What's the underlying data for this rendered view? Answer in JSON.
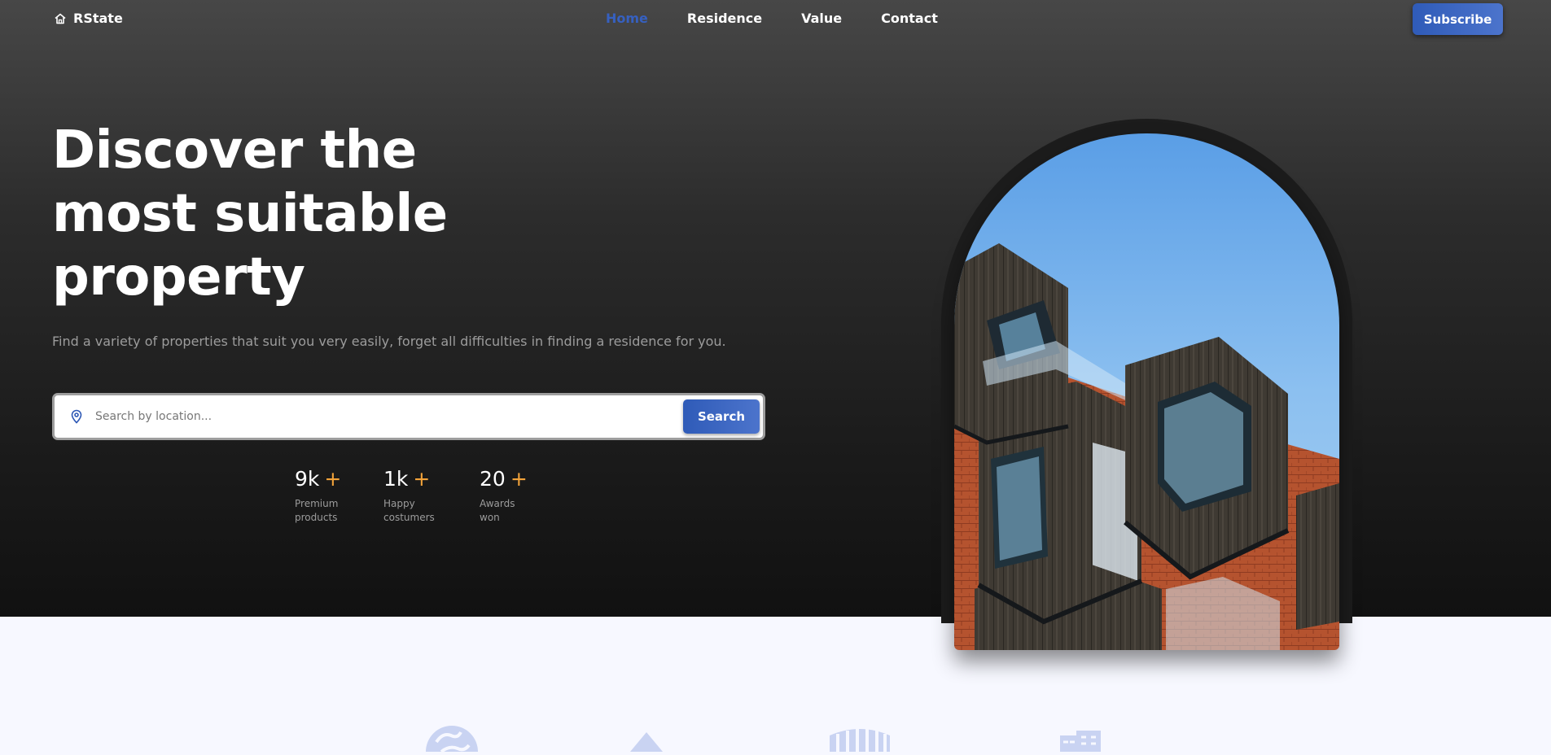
{
  "nav": {
    "logo_text": "RState",
    "items": [
      {
        "label": "Home",
        "active": true
      },
      {
        "label": "Residence",
        "active": false
      },
      {
        "label": "Value",
        "active": false
      },
      {
        "label": "Contact",
        "active": false
      }
    ],
    "subscribe_label": "Subscribe"
  },
  "hero": {
    "title_lines": [
      "Discover the",
      "most suitable",
      "property"
    ],
    "subtitle": "Find a variety of properties that suit you very easily, forget all difficulties in finding a residence for you.",
    "search": {
      "placeholder": "Search by location...",
      "value": "",
      "button_label": "Search"
    },
    "stats": [
      {
        "value": "9k",
        "suffix": "+",
        "label_lines": [
          "Premium",
          "products"
        ]
      },
      {
        "value": "1k",
        "suffix": "+",
        "label_lines": [
          "Happy",
          "costumers"
        ]
      },
      {
        "value": "20",
        "suffix": "+",
        "label_lines": [
          "Awards",
          "won"
        ]
      }
    ]
  },
  "features": {
    "icons": [
      "globe-icon",
      "triangle-icon",
      "building-columns-icon",
      "city-icon"
    ]
  },
  "colors": {
    "accent": "#3660c0",
    "stat_plus": "#f2a33a",
    "hero_bg_top": "#474747",
    "hero_bg_bottom": "#111111",
    "page_bg": "#f7f8ff"
  }
}
